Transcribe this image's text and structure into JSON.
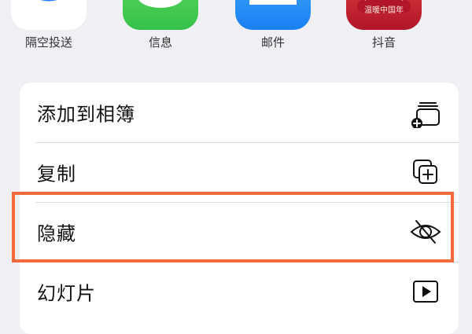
{
  "share_apps": [
    {
      "label": "隔空投送",
      "icon": "airdrop-icon",
      "color": "#1a7ff4"
    },
    {
      "label": "信息",
      "icon": "messages-icon",
      "color": "#35c24a"
    },
    {
      "label": "邮件",
      "icon": "mail-icon",
      "color": "#1a7ff4"
    },
    {
      "label": "抖音",
      "icon": "douyin-icon",
      "color": "#d3222d",
      "icon_text": "温暖中国年"
    }
  ],
  "actions": [
    {
      "label": "添加到相簿",
      "icon": "add-to-album-icon"
    },
    {
      "label": "复制",
      "icon": "copy-icon"
    },
    {
      "label": "隐藏",
      "icon": "eye-slash-icon",
      "highlighted": true
    },
    {
      "label": "幻灯片",
      "icon": "play-icon"
    }
  ],
  "colors": {
    "highlight_border": "#f26a3b",
    "background": "#efeff4",
    "card": "#ffffff"
  }
}
